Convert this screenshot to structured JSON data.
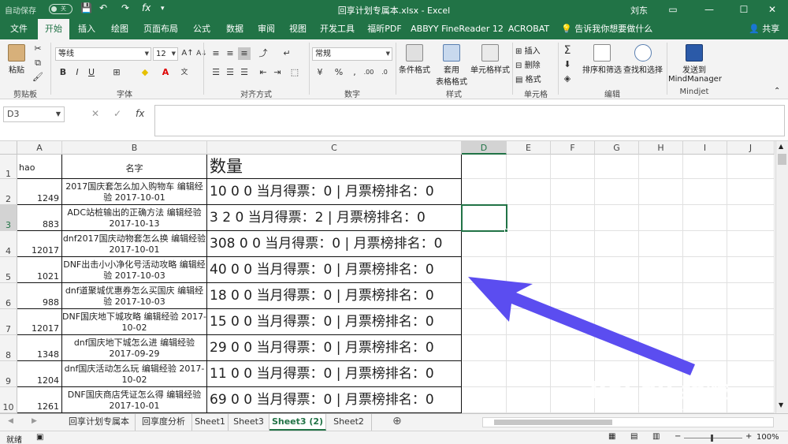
{
  "titlebar": {
    "autosave": "自动保存",
    "toggle": "关",
    "title": "回享计划专属本.xlsx  -  Excel",
    "user": "刘东",
    "qa_save": "💾",
    "qa_undo": "↶",
    "qa_redo": "↷",
    "qa_fx": "fx",
    "qa_more": "▾"
  },
  "tabs": [
    "文件",
    "开始",
    "插入",
    "绘图",
    "页面布局",
    "公式",
    "数据",
    "审阅",
    "视图",
    "开发工具",
    "福昕PDF",
    "ABBYY FineReader 12",
    "ACROBAT"
  ],
  "tell_me": "告诉我你想要做什么",
  "share": "共享",
  "ribbon": {
    "paste": "粘贴",
    "font_name": "等线",
    "font_size": "12",
    "bold": "B",
    "italic": "I",
    "underline": "U",
    "number_format": "常规",
    "cond_format": "条件格式",
    "table_format_1": "套用",
    "table_format_2": "表格格式",
    "cell_style": "单元格样式",
    "insert": "插入",
    "delete": "删除",
    "format": "格式",
    "sort_filter": "排序和筛选",
    "find_select": "查找和选择",
    "send_to_1": "发送到",
    "send_to_2": "MindManager",
    "groups": [
      "剪贴板",
      "字体",
      "对齐方式",
      "数字",
      "样式",
      "单元格",
      "编辑",
      "Mindjet"
    ]
  },
  "namebox": "D3",
  "fx": "fx",
  "columns": [
    "A",
    "B",
    "C",
    "D",
    "E",
    "F",
    "G",
    "H",
    "I",
    "J"
  ],
  "header_row": {
    "a": "hao",
    "b": "名字",
    "c": "数量"
  },
  "rows": [
    {
      "n": "2",
      "a": "1249",
      "b": "2017国庆套怎么加入购物车 编辑经验 2017-10-01",
      "c": "10 0 0 当月得票：0 | 月票榜排名：0"
    },
    {
      "n": "3",
      "a": "883",
      "b": "ADC站桩输出的正确方法 编辑经验 2017-10-13",
      "c": "3 2 0 当月得票：2 | 月票榜排名：0"
    },
    {
      "n": "4",
      "a": "12017",
      "b": "dnf2017国庆动物套怎么换 编辑经验 2017-10-01",
      "c": "308 0 0 当月得票：0 | 月票榜排名：0"
    },
    {
      "n": "5",
      "a": "1021",
      "b": "DNF出击小小净化号活动攻略 编辑经验 2017-10-03",
      "c": "40 0 0 当月得票：0 | 月票榜排名：0"
    },
    {
      "n": "6",
      "a": "988",
      "b": "dnf道聚城优惠券怎么买国庆 编辑经验 2017-10-03",
      "c": "18 0 0 当月得票：0 | 月票榜排名：0"
    },
    {
      "n": "7",
      "a": "12017",
      "b": "DNF国庆地下城攻略 编辑经验 2017-10-02",
      "c": "15 0 0 当月得票：0 | 月票榜排名：0"
    },
    {
      "n": "8",
      "a": "1348",
      "b": "dnf国庆地下城怎么进 编辑经验 2017-09-29",
      "c": "29 0 0 当月得票：0 | 月票榜排名：0"
    },
    {
      "n": "9",
      "a": "1204",
      "b": "dnf国庆活动怎么玩 编辑经验 2017-10-02",
      "c": "11 0 0 当月得票：0 | 月票榜排名：0"
    },
    {
      "n": "10",
      "a": "1261",
      "b": "DNF国庆商店凭证怎么得 编辑经验 2017-10-01",
      "c": "69 0 0 当月得票：0 | 月票榜排名：0"
    }
  ],
  "sheets": [
    "回享计划专属本",
    "回享度分析",
    "Sheet1",
    "Sheet3",
    "Sheet3 (2)",
    "Sheet2"
  ],
  "active_sheet": "Sheet3 (2)",
  "status": {
    "ready": "就绪",
    "zoom": "100%"
  },
  "watermark": {
    "brand": "Bai du 经验",
    "url": "jingyan.baidu.com"
  },
  "colors": {
    "excel_green": "#217346",
    "arrow": "#5b4df0"
  }
}
